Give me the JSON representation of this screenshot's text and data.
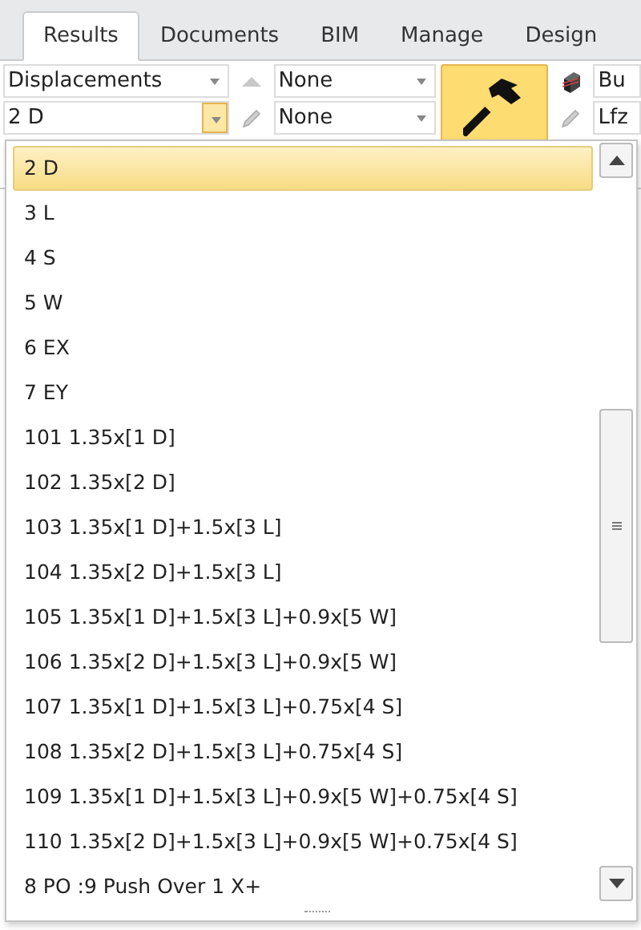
{
  "tabs": [
    {
      "label": "Results",
      "selected": true
    },
    {
      "label": "Documents",
      "selected": false
    },
    {
      "label": "BIM",
      "selected": false
    },
    {
      "label": "Manage",
      "selected": false
    },
    {
      "label": "Design",
      "selected": false
    }
  ],
  "ribbon": {
    "result_type": {
      "value": "Displacements"
    },
    "load_case": {
      "value": "2 D",
      "open": true
    },
    "filter_1": {
      "value": "None"
    },
    "filter_2": {
      "value": "None"
    },
    "field_3": {
      "value": "Bu"
    },
    "field_4": {
      "value": "Lfz"
    }
  },
  "dropdown": {
    "items": [
      {
        "label": "2 D",
        "selected": true
      },
      {
        "label": "3 L",
        "selected": false
      },
      {
        "label": "4 S",
        "selected": false
      },
      {
        "label": "5 W",
        "selected": false
      },
      {
        "label": "6 EX",
        "selected": false
      },
      {
        "label": "7 EY",
        "selected": false
      },
      {
        "label": "101 1.35x[1 D]",
        "selected": false
      },
      {
        "label": "102 1.35x[2 D]",
        "selected": false
      },
      {
        "label": "103 1.35x[1 D]+1.5x[3 L]",
        "selected": false
      },
      {
        "label": "104 1.35x[2 D]+1.5x[3 L]",
        "selected": false
      },
      {
        "label": "105 1.35x[1 D]+1.5x[3 L]+0.9x[5 W]",
        "selected": false
      },
      {
        "label": "106 1.35x[2 D]+1.5x[3 L]+0.9x[5 W]",
        "selected": false
      },
      {
        "label": "107 1.35x[1 D]+1.5x[3 L]+0.75x[4 S]",
        "selected": false
      },
      {
        "label": "108 1.35x[2 D]+1.5x[3 L]+0.75x[4 S]",
        "selected": false
      },
      {
        "label": "109 1.35x[1 D]+1.5x[3 L]+0.9x[5 W]+0.75x[4 S]",
        "selected": false
      },
      {
        "label": "110 1.35x[2 D]+1.5x[3 L]+0.9x[5 W]+0.75x[4 S]",
        "selected": false
      },
      {
        "label": "8 PO :9 Push Over 1 X+",
        "selected": false
      }
    ]
  }
}
